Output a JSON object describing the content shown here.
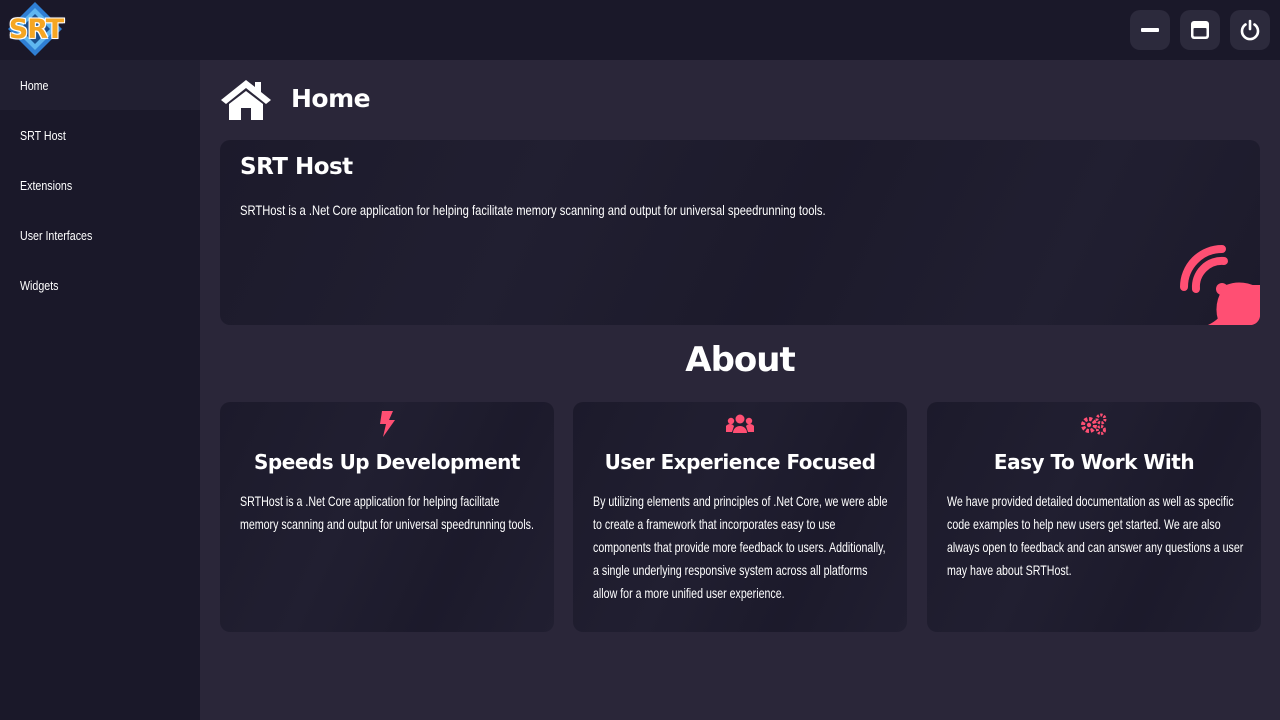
{
  "app": {
    "logo_text": "SRT"
  },
  "window_controls": {
    "minimize_icon": "minimize-icon",
    "maximize_icon": "maximize-icon",
    "power_icon": "power-icon"
  },
  "sidebar": {
    "items": [
      {
        "label": "Home",
        "active": true
      },
      {
        "label": "SRT Host",
        "active": false
      },
      {
        "label": "Extensions",
        "active": false
      },
      {
        "label": "User Interfaces",
        "active": false
      },
      {
        "label": "Widgets",
        "active": false
      }
    ]
  },
  "header": {
    "title": "Home",
    "icon": "home-icon"
  },
  "hero": {
    "title": "SRT Host",
    "description": "SRTHost is a .Net Core application for helping facilitate memory scanning and output for universal speedrunning tools.",
    "icon": "satellite-dish-icon"
  },
  "about": {
    "title": "About",
    "cards": [
      {
        "icon": "bolt-icon",
        "title": "Speeds Up Development",
        "body": "SRTHost is a .Net Core application for helping facilitate memory scanning and output for universal speedrunning tools."
      },
      {
        "icon": "users-icon",
        "title": "User Experience Focused",
        "body": "By utilizing elements and principles of .Net Core, we were able to create a framework that incorporates easy to use components that provide more feedback to users. Additionally, a single underlying responsive system across all platforms allow for a more unified user experience."
      },
      {
        "icon": "cogs-icon",
        "title": "Easy To Work With",
        "body": "We have provided detailed documentation as well as specific code examples to help new users get started. We are also always open to feedback and can answer any questions a user may have about SRTHost."
      }
    ]
  },
  "colors": {
    "accent": "#ff4f73",
    "background": "#2a2639",
    "panel": "#1a1829",
    "card": "#1c1a2b",
    "logo": "#f5a623"
  }
}
